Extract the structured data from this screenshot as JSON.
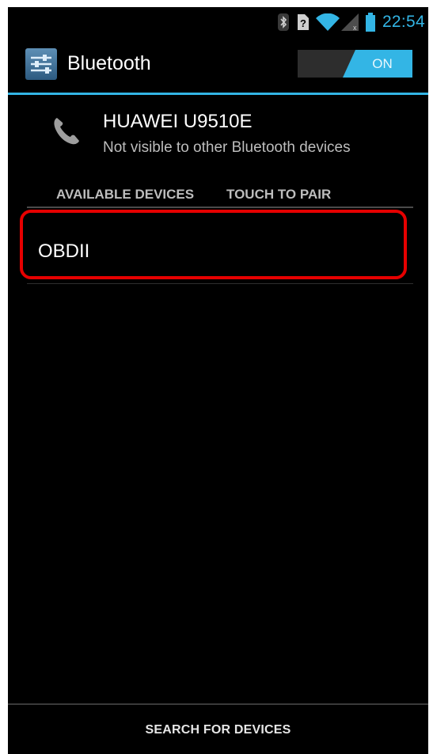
{
  "status_bar": {
    "time": "22:54",
    "icons": [
      "bluetooth-icon",
      "unknown-sim-icon",
      "wifi-icon",
      "signal-icon",
      "battery-icon"
    ],
    "accent_color": "#33b5e5"
  },
  "action_bar": {
    "title": "Bluetooth",
    "app_icon": "settings-icon",
    "toggle_label": "ON"
  },
  "own_device": {
    "name": "HUAWEI U9510E",
    "subtitle": "Not visible to other Bluetooth devices",
    "icon": "phone-icon"
  },
  "available_devices": {
    "header_left": "AVAILABLE DEVICES",
    "header_right": "TOUCH TO PAIR",
    "items": [
      {
        "label": "OBDII"
      }
    ]
  },
  "bottom_bar": {
    "search_label": "SEARCH FOR DEVICES"
  }
}
